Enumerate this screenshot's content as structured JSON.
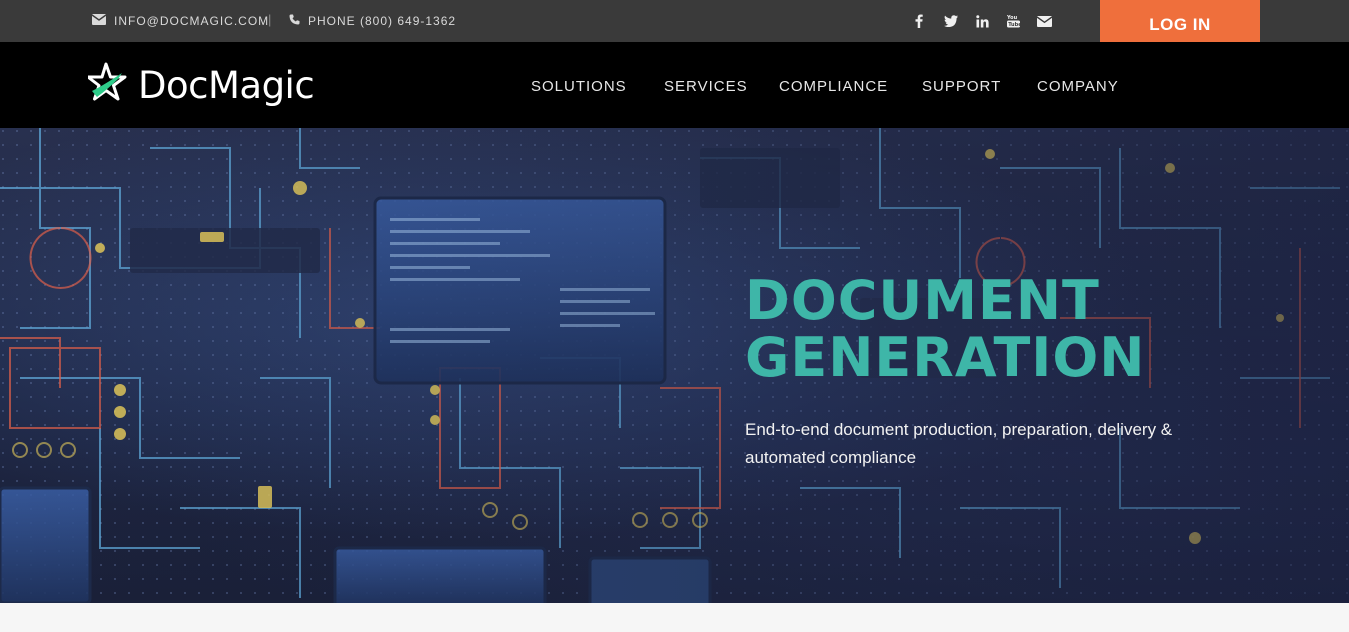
{
  "topbar": {
    "email_label": "INFO@DOCMAGIC.COM",
    "separator": "|",
    "phone_label": "PHONE (800) 649-1362",
    "social_icons": [
      "facebook-icon",
      "twitter-icon",
      "linkedin-icon",
      "youtube-icon",
      "email-icon"
    ],
    "login_label": "LOG IN"
  },
  "brand": {
    "name": "DocMagic"
  },
  "nav": {
    "items": [
      {
        "label": "SOLUTIONS"
      },
      {
        "label": "SERVICES"
      },
      {
        "label": "COMPLIANCE"
      },
      {
        "label": "SUPPORT"
      },
      {
        "label": "COMPANY"
      }
    ]
  },
  "hero": {
    "title_line1": "DOCUMENT",
    "title_line2": "GENERATION",
    "subtitle": "End-to-end document production, preparation, delivery & automated compliance"
  },
  "colors": {
    "topbar_bg": "#3a3a3a",
    "nav_bg": "#000000",
    "accent_orange": "#ef6f3c",
    "title_teal": "#3eb6a8",
    "logo_green": "#2ecc8a"
  }
}
